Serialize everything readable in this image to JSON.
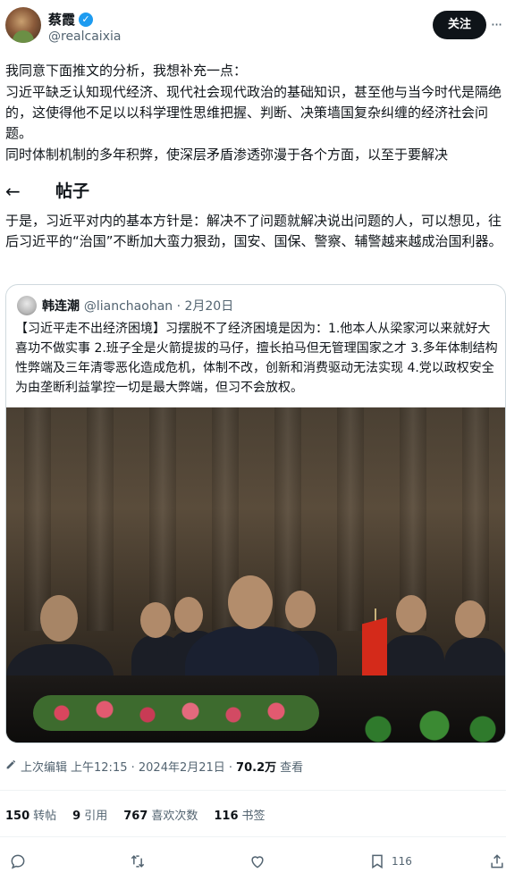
{
  "author": {
    "name": "蔡霞",
    "handle": "@realcaixia",
    "follow_label": "关注",
    "verified": true
  },
  "post": {
    "line1": "我同意下面推文的分析，我想补充一点：",
    "para2": "习近平缺乏认知现代经济、现代社会现代政治的基础知识，甚至他与当今时代是隔绝的，这使得他不足以以科学理性思维把握、判断、决策墙国复杂纠缠的经济社会问题。",
    "line3": "同时体制机制的多年积弊，使深层矛盾渗透弥漫于各个方面，以至于要解决",
    "para4": "于是，习近平对内的基本方针是：解决不了问题就解决说出问题的人，可以想见，往后习近平的“治国”不断加大蛮力狠劲，国安、国保、警察、辅警越来越成治国利器。"
  },
  "sticky_header": {
    "back_icon": "arrow-left-icon",
    "title": "帖子"
  },
  "quoted_post": {
    "name": "韩连潮",
    "handle_date": "@lianchaohan · 2月20日",
    "text": "【习近平走不出经济困境】习摆脱不了经济困境是因为：1.他本人从梁家河以来就好大喜功不做实事 2.班子全是火箭提拔的马仔，擅长拍马但无管理国家之才 3.多年体制结构性弊端及三年清零恶化造成危机，体制不改，创新和消费驱动无法实现 4.党以政权安全为由垄断利益掌控一切是最大弊端，但习不会放权。"
  },
  "meta": {
    "edited_label": "上次编辑",
    "time": "上午12:15 · 2024年2月21日 ·",
    "views_value": "70.2万",
    "views_label": "查看"
  },
  "stats": [
    {
      "value": "150",
      "label": "转帖"
    },
    {
      "value": "9",
      "label": "引用"
    },
    {
      "value": "767",
      "label": "喜欢次数"
    },
    {
      "value": "116",
      "label": "书签"
    }
  ],
  "actions": {
    "bookmark_count": "116"
  },
  "colors": {
    "accent": "#1d9bf0",
    "text": "#0f1419",
    "muted": "#536471",
    "border": "#cfd9de"
  }
}
